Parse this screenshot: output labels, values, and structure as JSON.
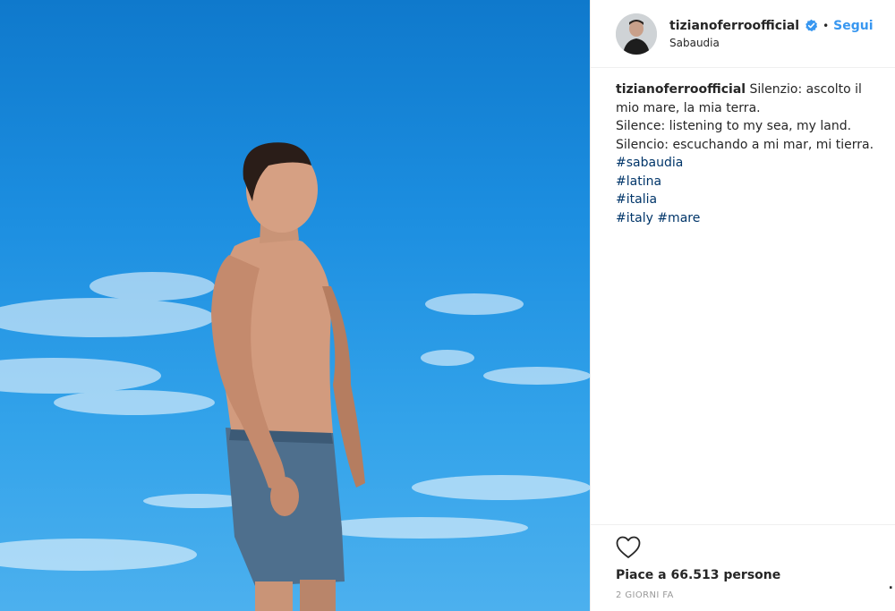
{
  "header": {
    "username": "tizianoferroofficial",
    "separator": "•",
    "follow_label": "Segui",
    "location": "Sabaudia"
  },
  "caption": {
    "username": "tizianoferroofficial",
    "text_line1": "Silenzio: ascolto il mio mare, la mia terra.",
    "text_line2": "Silence: listening to my sea, my land.",
    "text_line3": "Silencio: escuchando a mi mar, mi tierra.",
    "hashtags": [
      "#sabaudia",
      "#latina",
      "#italia",
      "#italy",
      "#mare"
    ]
  },
  "footer": {
    "likes": "Piace a 66.513 persone",
    "time": "2 GIORNI FA",
    "more": "."
  },
  "colors": {
    "link": "#3897f0",
    "hashtag": "#003569",
    "sky": "#1c8ee0"
  },
  "icons": [
    "verified-badge-icon",
    "heart-icon"
  ]
}
